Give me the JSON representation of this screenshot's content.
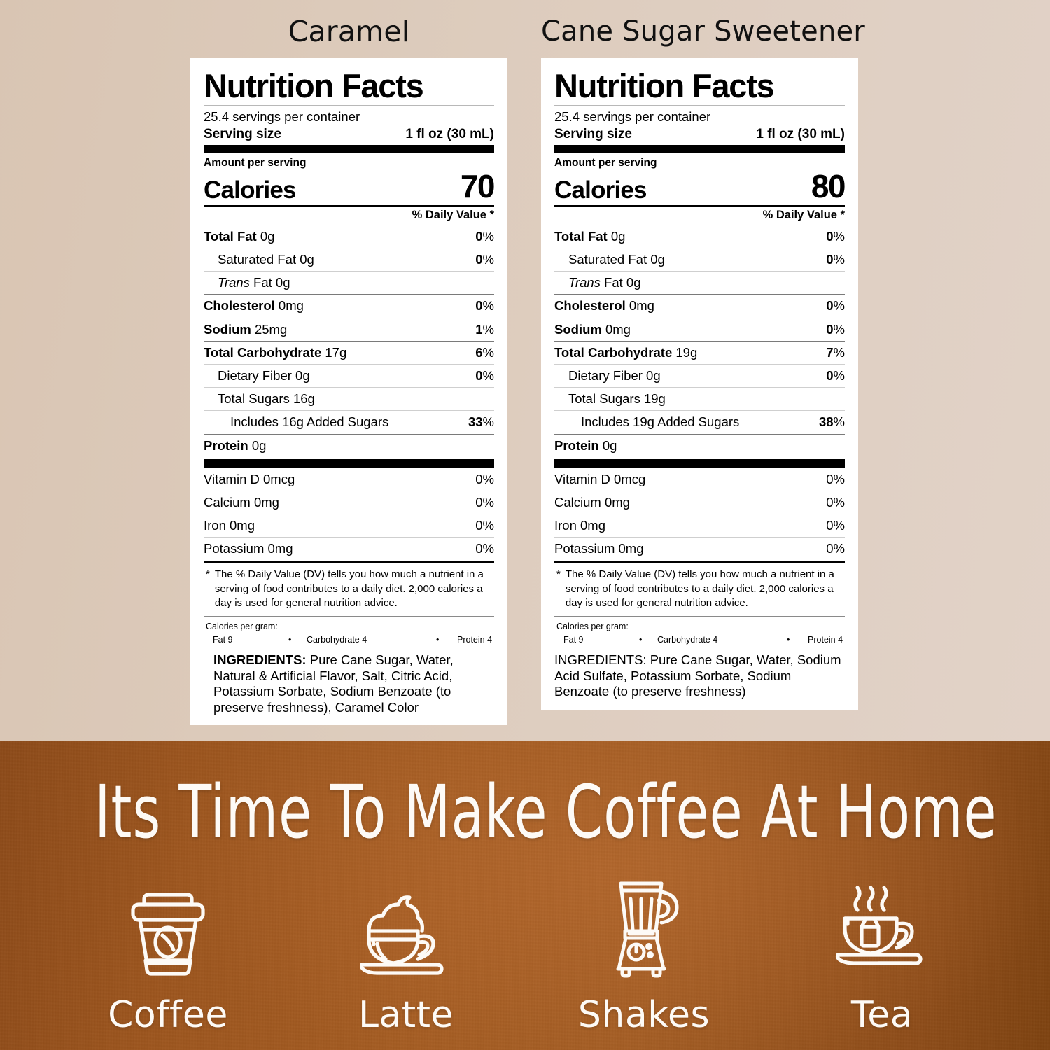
{
  "theme": {
    "page_bg_top": "#ddccbd",
    "banner_bg": "#a05a21",
    "label_bg": "#ffffff",
    "ink": "#000000",
    "banner_text": "#fdfaf6"
  },
  "labels": [
    {
      "flavor": "Caramel",
      "title": "Nutrition Facts",
      "servings_per_container": "25.4 servings per container",
      "serving_size_label": "Serving size",
      "serving_size_value": "1 fl oz (30 mL)",
      "amount_per_serving": "Amount per serving",
      "calories_label": "Calories",
      "calories_value": "70",
      "daily_value_header": "% Daily Value *",
      "nutrients": [
        {
          "name": "Total Fat",
          "bold": true,
          "amount": "0g",
          "dv": "0",
          "indent": 0,
          "major": true
        },
        {
          "name": "Saturated Fat",
          "bold": false,
          "amount": "0g",
          "dv": "0",
          "indent": 1,
          "major": false
        },
        {
          "name": "Trans",
          "italic_prefix": true,
          "suffix": " Fat 0g",
          "amount": "",
          "dv": "",
          "indent": 1,
          "major": false
        },
        {
          "name": "Cholesterol",
          "bold": true,
          "amount": "0mg",
          "dv": "0",
          "indent": 0,
          "major": true
        },
        {
          "name": "Sodium",
          "bold": true,
          "amount": "25mg",
          "dv": "1",
          "indent": 0,
          "major": true
        },
        {
          "name": "Total Carbohydrate",
          "bold": true,
          "amount": "17g",
          "dv": "6",
          "indent": 0,
          "major": true
        },
        {
          "name": "Dietary Fiber",
          "bold": false,
          "amount": "0g",
          "dv": "0",
          "indent": 1,
          "major": false
        },
        {
          "name": "Total Sugars",
          "bold": false,
          "amount": "16g",
          "dv": "",
          "indent": 1,
          "major": false
        },
        {
          "name": "Includes 16g Added Sugars",
          "bold": false,
          "amount": "",
          "dv": "33",
          "indent": 2,
          "major": false
        },
        {
          "name": "Protein",
          "bold": true,
          "amount": "0g",
          "dv": "",
          "indent": 0,
          "major": true
        }
      ],
      "vitamins": [
        {
          "name": "Vitamin D 0mcg",
          "dv": "0%"
        },
        {
          "name": "Calcium 0mg",
          "dv": "0%"
        },
        {
          "name": "Iron 0mg",
          "dv": "0%"
        },
        {
          "name": "Potassium 0mg",
          "dv": "0%"
        }
      ],
      "footnote_star": "*",
      "footnote": "The % Daily Value (DV) tells you how much a nutrient in a serving of food contributes to a daily diet. 2,000 calories a day is used for general nutrition advice.",
      "calories_per_gram_title": "Calories per gram:",
      "calories_per_gram": {
        "fat": "Fat 9",
        "dot1": "•",
        "carb": "Carbohydrate 4",
        "dot2": "•",
        "protein": "Protein 4"
      },
      "ingredients_heading": "INGREDIENTS:",
      "ingredients_body": " Pure Cane Sugar, Water, Natural & Artificial Flavor, Salt, Citric Acid, Potassium Sorbate, Sodium Benzoate (to preserve freshness), Caramel Color"
    },
    {
      "flavor": "Cane Sugar Sweetener",
      "title": "Nutrition Facts",
      "servings_per_container": "25.4 servings per container",
      "serving_size_label": "Serving size",
      "serving_size_value": "1 fl oz (30 mL)",
      "amount_per_serving": "Amount per serving",
      "calories_label": "Calories",
      "calories_value": "80",
      "daily_value_header": "% Daily Value *",
      "nutrients": [
        {
          "name": "Total Fat",
          "bold": true,
          "amount": "0g",
          "dv": "0",
          "indent": 0,
          "major": true
        },
        {
          "name": "Saturated Fat",
          "bold": false,
          "amount": "0g",
          "dv": "0",
          "indent": 1,
          "major": false
        },
        {
          "name": "Trans",
          "italic_prefix": true,
          "suffix": " Fat 0g",
          "amount": "",
          "dv": "",
          "indent": 1,
          "major": false
        },
        {
          "name": "Cholesterol",
          "bold": true,
          "amount": "0mg",
          "dv": "0",
          "indent": 0,
          "major": true
        },
        {
          "name": "Sodium",
          "bold": true,
          "amount": "0mg",
          "dv": "0",
          "indent": 0,
          "major": true
        },
        {
          "name": "Total Carbohydrate",
          "bold": true,
          "amount": "19g",
          "dv": "7",
          "indent": 0,
          "major": true
        },
        {
          "name": "Dietary Fiber",
          "bold": false,
          "amount": "0g",
          "dv": "0",
          "indent": 1,
          "major": false
        },
        {
          "name": "Total Sugars",
          "bold": false,
          "amount": "19g",
          "dv": "",
          "indent": 1,
          "major": false
        },
        {
          "name": "Includes 19g Added Sugars",
          "bold": false,
          "amount": "",
          "dv": "38",
          "indent": 2,
          "major": false
        },
        {
          "name": "Protein",
          "bold": true,
          "amount": "0g",
          "dv": "",
          "indent": 0,
          "major": true
        }
      ],
      "vitamins": [
        {
          "name": "Vitamin D 0mcg",
          "dv": "0%"
        },
        {
          "name": "Calcium 0mg",
          "dv": "0%"
        },
        {
          "name": "Iron 0mg",
          "dv": "0%"
        },
        {
          "name": "Potassium 0mg",
          "dv": "0%"
        }
      ],
      "footnote_star": "*",
      "footnote": "The % Daily Value (DV) tells you how much a nutrient in a serving of food contributes to a daily diet. 2,000 calories a day is used for general nutrition advice.",
      "calories_per_gram_title": "Calories per gram:",
      "calories_per_gram": {
        "fat": "Fat 9",
        "dot1": "•",
        "carb": "Carbohydrate 4",
        "dot2": "•",
        "protein": "Protein 4"
      },
      "ingredients_heading": "INGREDIENTS:",
      "ingredients_body": " Pure Cane Sugar, Water, Sodium Acid Sulfate, Potassium Sorbate, Sodium Benzoate (to preserve freshness)"
    }
  ],
  "banner": {
    "heading": "Its Time To Make Coffee At Home",
    "features": [
      {
        "label": "Coffee",
        "icon": "to-go-coffee-cup-icon"
      },
      {
        "label": "Latte",
        "icon": "latte-cup-saucer-icon"
      },
      {
        "label": "Shakes",
        "icon": "blender-icon"
      },
      {
        "label": "Tea",
        "icon": "tea-cup-teabag-icon"
      }
    ]
  }
}
